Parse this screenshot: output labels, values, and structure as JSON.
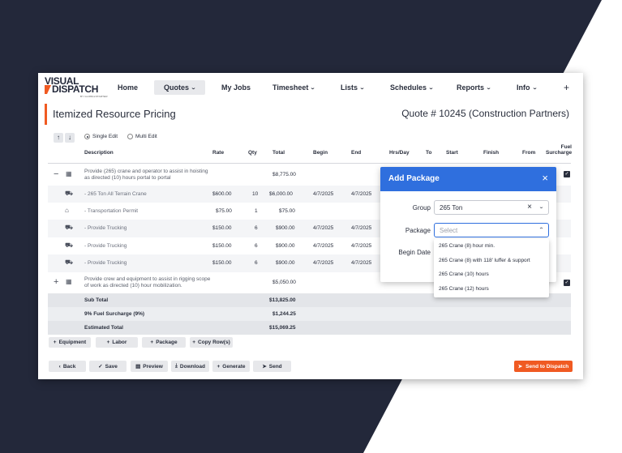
{
  "colors": {
    "accent": "#f05a22",
    "modal_header": "#2f6fde",
    "dark_bg": "#23283a"
  },
  "logo": {
    "line1": "VISUAL",
    "line2": "DISPATCH",
    "sub": "BY GLOBALSTARTER"
  },
  "nav": {
    "items": [
      {
        "label": "Home"
      },
      {
        "label": "Quotes"
      },
      {
        "label": "My Jobs"
      },
      {
        "label": "Timesheet"
      },
      {
        "label": "Lists"
      },
      {
        "label": "Schedules"
      },
      {
        "label": "Reports"
      },
      {
        "label": "Info"
      }
    ],
    "add_label": "+"
  },
  "page": {
    "title": "Itemized Resource Pricing",
    "quote": "Quote # 10245 (Construction Partners)"
  },
  "toolbar": {
    "single_edit": "Single Edit",
    "multi_edit": "Multi Edit"
  },
  "columns": {
    "description": "Description",
    "rate": "Rate",
    "qty": "Qty",
    "total": "Total",
    "begin": "Begin",
    "end": "End",
    "hrs_day": "Hrs/Day",
    "to": "To",
    "start": "Start",
    "finish": "Finish",
    "from": "From",
    "fuel1": "Fuel",
    "fuel2": "Surcharge"
  },
  "rows": [
    {
      "desc": "Provide (265) crane and operator to assist in hoisting as directed (10) hours portal to portal",
      "total": "$8,775.00"
    },
    {
      "desc": "- 265 Ton All Terrain Crane",
      "rate": "$600.00",
      "qty": "10",
      "total": "$6,000.00",
      "begin": "4/7/2025",
      "end": "4/7/2025"
    },
    {
      "desc": "- Transportation Permit",
      "rate": "$75.00",
      "qty": "1",
      "total": "$75.00"
    },
    {
      "desc": "- Provide Trucking",
      "rate": "$150.00",
      "qty": "6",
      "total": "$900.00",
      "begin": "4/7/2025",
      "end": "4/7/2025"
    },
    {
      "desc": "- Provide Trucking",
      "rate": "$150.00",
      "qty": "6",
      "total": "$900.00",
      "begin": "4/7/2025",
      "end": "4/7/2025"
    },
    {
      "desc": "- Provide Trucking",
      "rate": "$150.00",
      "qty": "6",
      "total": "$900.00",
      "begin": "4/7/2025",
      "end": "4/7/2025"
    },
    {
      "desc": "Provide crew and equipment to assist in rigging scope of work as directed (10) hour mobilization.",
      "total": "$5,050.00"
    }
  ],
  "summary": [
    {
      "label": "Sub Total",
      "value": "$13,825.00"
    },
    {
      "label": "9% Fuel Surcharge (9%)",
      "value": "$1,244.25"
    },
    {
      "label": "Estimated Total",
      "value": "$15,069.25"
    }
  ],
  "add_buttons": [
    "Equipment",
    "Labor",
    "Package",
    "Copy Row(s)"
  ],
  "bottom_buttons": [
    "Back",
    "Save",
    "Preview",
    "Download",
    "Generate",
    "Send"
  ],
  "dispatch_label": "Send to Dispatch",
  "modal": {
    "title": "Add Package",
    "group_label": "Group",
    "group_value": "265 Ton",
    "package_label": "Package",
    "package_placeholder": "Select",
    "begin_label": "Begin Date",
    "options": [
      "265 Crane (8) hour min.",
      "265 Crane (8) with 118' luffer & support",
      "265 Crane (10) hours",
      "265 Crane (12) hours"
    ]
  }
}
